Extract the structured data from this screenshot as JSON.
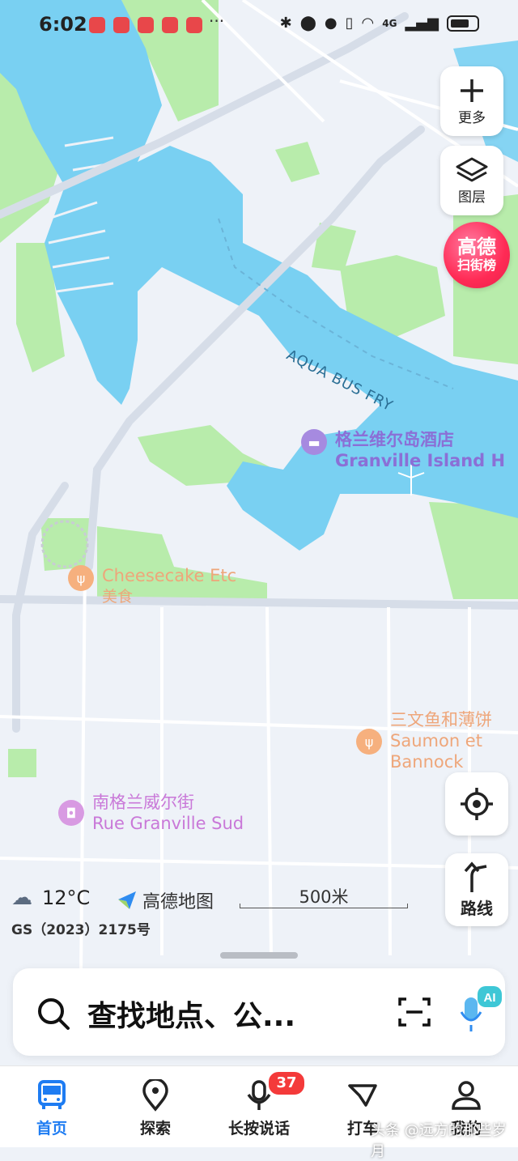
{
  "status_bar": {
    "time": "6:02",
    "more_indicator": "···",
    "network": "4G"
  },
  "map": {
    "water_label": "AQUA BUS FRY",
    "pois": [
      {
        "name_zh": "格兰维尔岛酒店",
        "name_en": "Granville Island H",
        "icon": "hotel-icon",
        "color": "#8b6fd6"
      },
      {
        "name_en": "Cheesecake Etc",
        "category": "美食",
        "icon": "restaurant-icon",
        "color": "#f2a271"
      },
      {
        "name_zh": "三文鱼和薄饼",
        "name_en_1": "Saumon et",
        "name_en_2": "Bannock",
        "icon": "restaurant-icon",
        "color": "#f2a271"
      },
      {
        "name_zh": "南格兰威尔街",
        "name_en": "Rue Granville Sud",
        "icon": "shopping-icon",
        "color": "#c978d8"
      }
    ],
    "water_color": "#79d0f2",
    "park_color": "#b8ecab",
    "land_color": "#eef2f8"
  },
  "controls": {
    "more_label": "更多",
    "layers_label": "图层",
    "hotlist_line1": "高德",
    "hotlist_line2": "扫街榜",
    "route_label": "路线"
  },
  "overlay": {
    "weather_temp": "12°C",
    "brand_name": "高德地图",
    "scale_label": "500米",
    "license": "GS（2023）2175号"
  },
  "search": {
    "placeholder": "查找地点、公..."
  },
  "tabs": [
    {
      "label": "首页",
      "icon": "bus-icon",
      "active": true
    },
    {
      "label": "探索",
      "icon": "location-pin-icon",
      "active": false
    },
    {
      "label": "长按说话",
      "icon": "microphone-icon",
      "active": false
    },
    {
      "label": "打车",
      "icon": "taxi-icon",
      "active": false
    },
    {
      "label": "我的",
      "icon": "profile-icon",
      "active": false
    }
  ],
  "badge_count": "37",
  "watermark": "头条 @远方的那些岁月",
  "accent_color": "#1e7cf2"
}
